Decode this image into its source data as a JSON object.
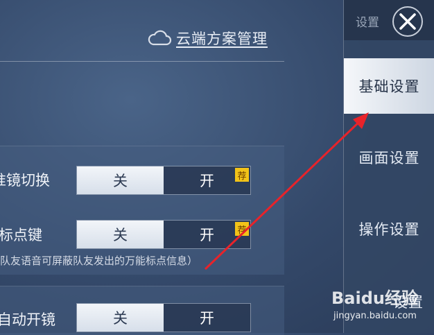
{
  "header": {
    "cloud_label": "云端方案管理"
  },
  "settings": [
    {
      "label": "准镜切换",
      "off_label": "关",
      "on_label": "开",
      "badge": "荐"
    },
    {
      "label": "标点键",
      "off_label": "关",
      "on_label": "开",
      "badge": "荐",
      "hint": "队友语音可屏蔽队友发出的万能标点信息）"
    },
    {
      "label": "自动开镜",
      "off_label": "关",
      "on_label": "开"
    }
  ],
  "sidebar": {
    "title": "设置",
    "items": [
      {
        "label": "基础设置",
        "active": true
      },
      {
        "label": "画面设置",
        "active": false
      },
      {
        "label": "操作设置",
        "active": false
      },
      {
        "label": "设置",
        "active": false
      }
    ]
  },
  "watermark": {
    "brand": "Baidu经验",
    "url": "jingyan.baidu.com"
  },
  "colors": {
    "arrow": "#e8232a",
    "badge": "#f2c318",
    "active_tab": "#f5f7fa"
  }
}
